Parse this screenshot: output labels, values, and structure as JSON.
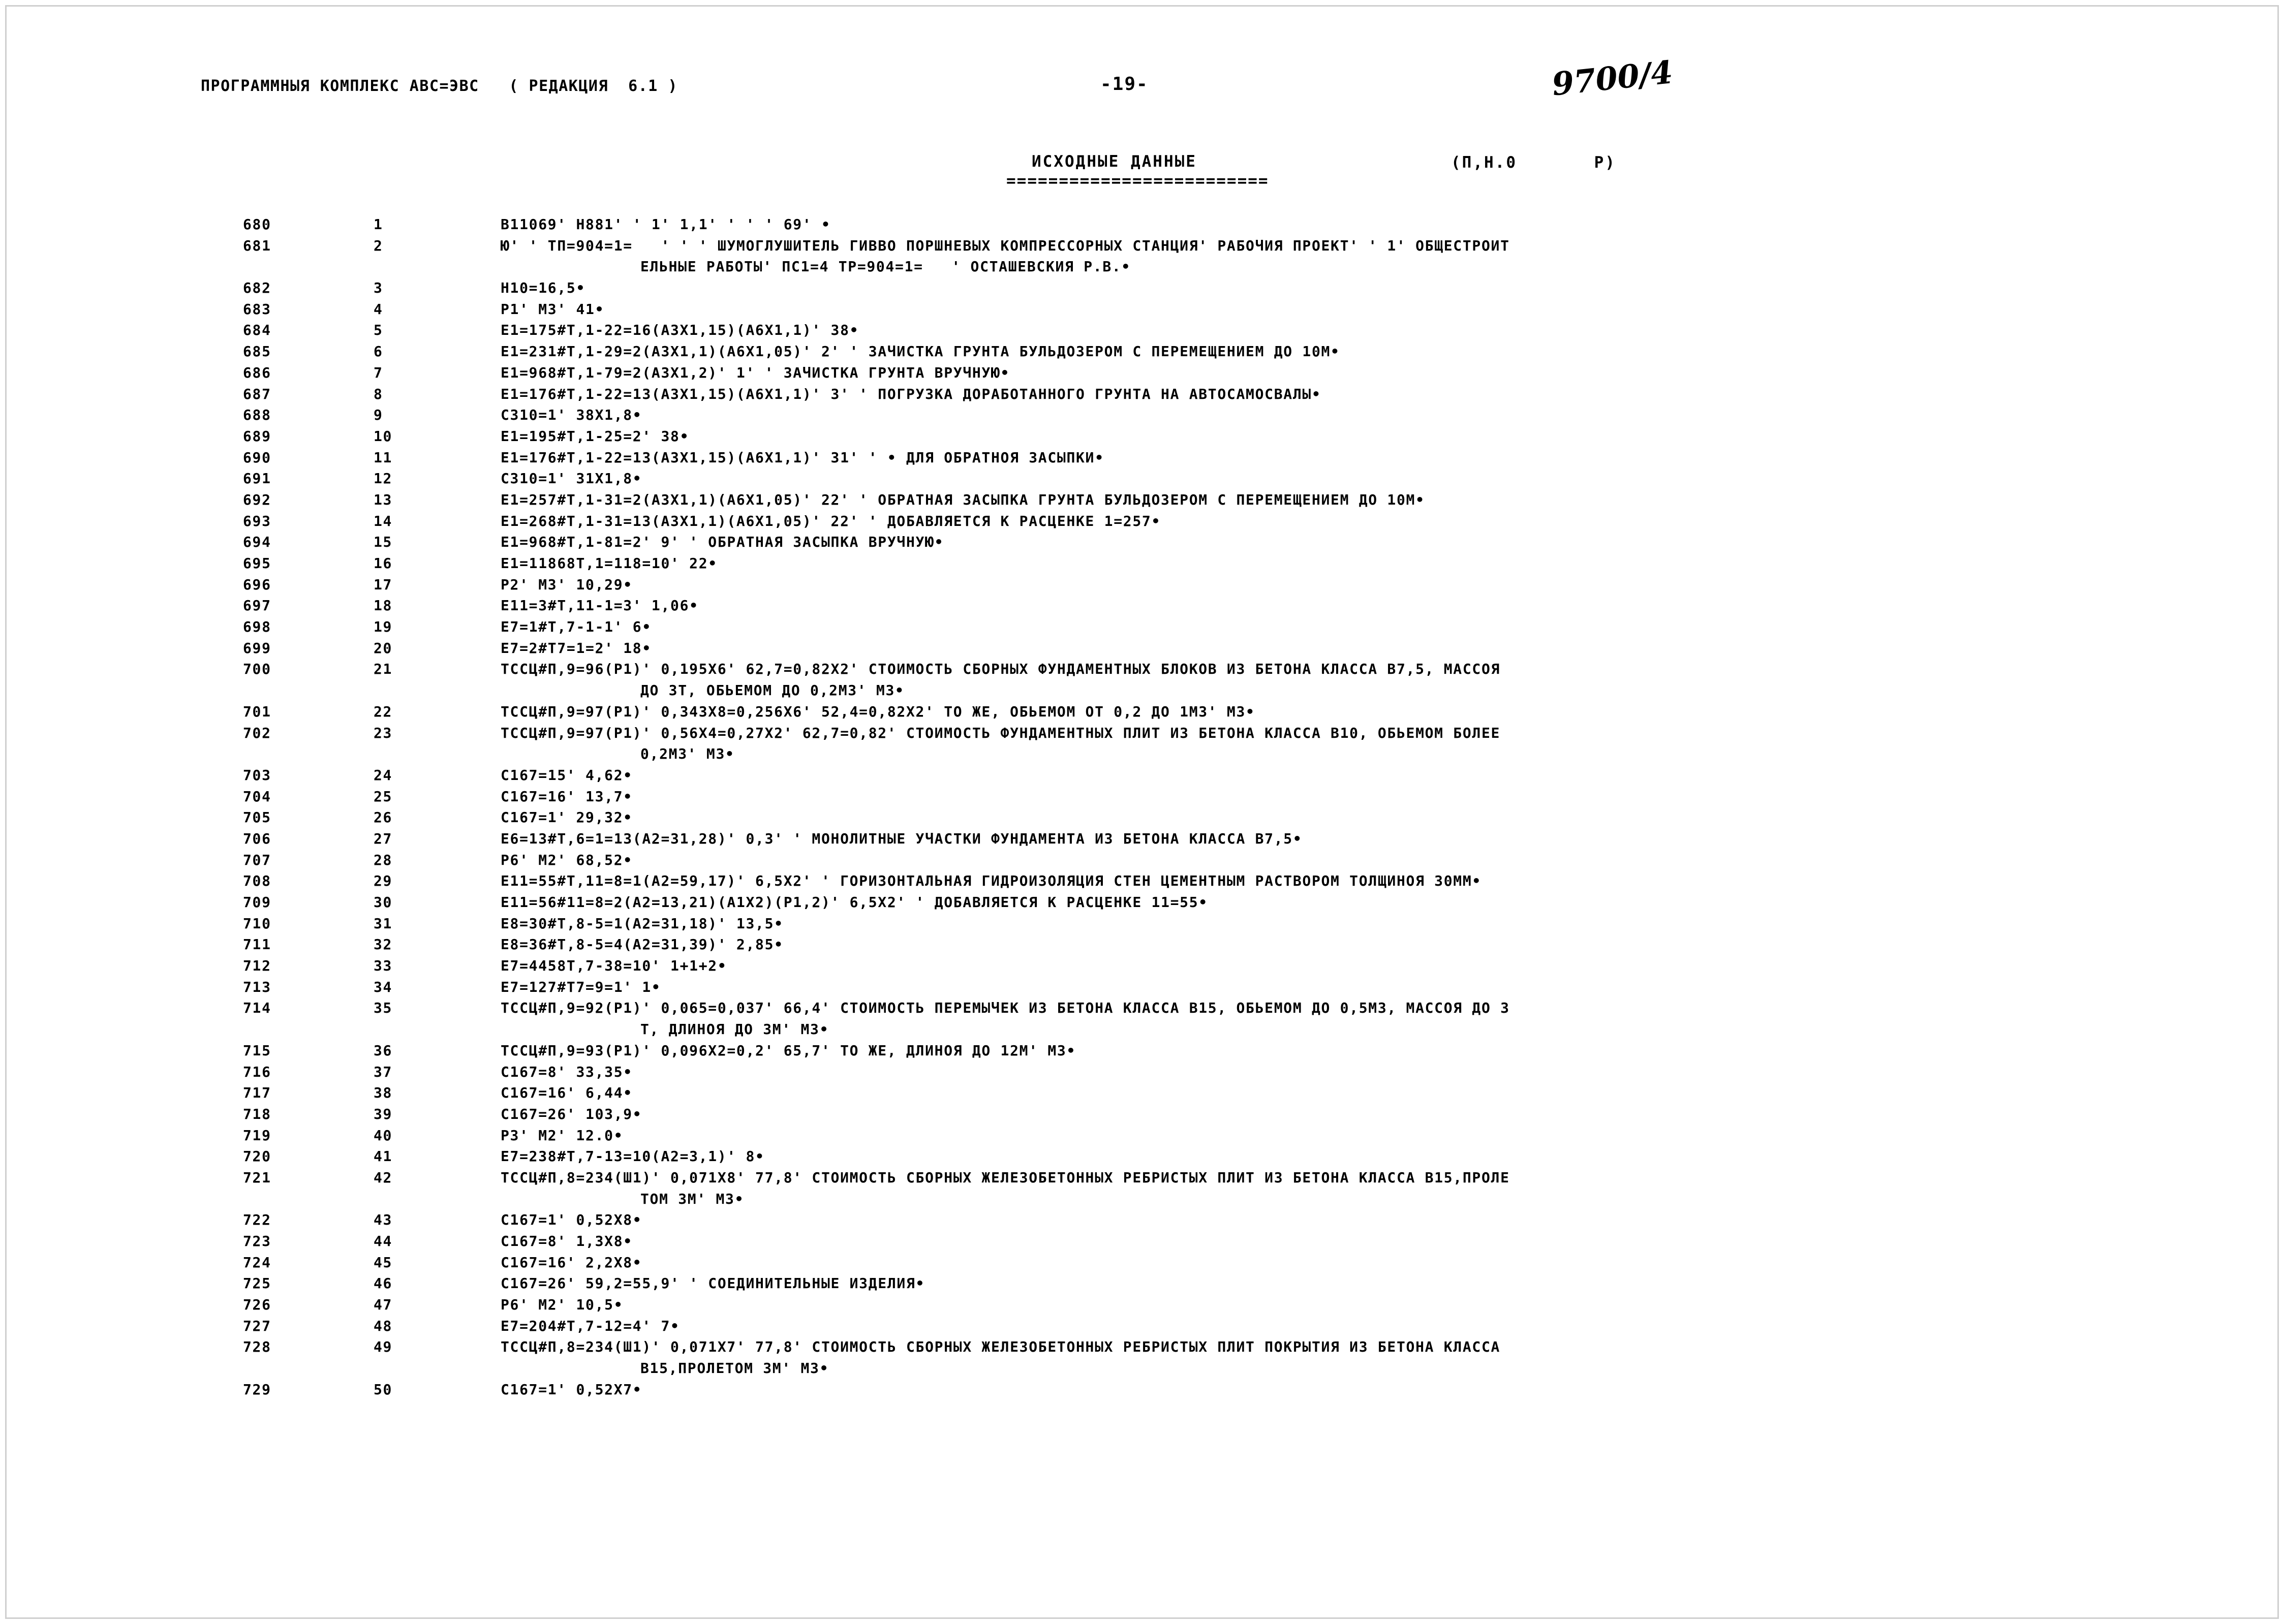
{
  "document": {
    "header": {
      "program_complex": "ПРОГРАММНЫЯ КОМПЛЕКС АВС=ЭВС   ( РЕДАКЦИЯ  6.1 )",
      "page_marker": "-19-",
      "handwritten_annotation": "9700/4",
      "section_title": "ИСХОДНЫЕ ДАННЫЕ",
      "section_rule": "=========================",
      "right_note": "(П,Н.0       Р)"
    },
    "rows": [
      {
        "num": "680",
        "seq": "1",
        "text": "B11069' H881' ' 1' 1,1' ' ' ' 69' •"
      },
      {
        "num": "681",
        "seq": "2",
        "text": "Ю' ' ТП=904=1=   ' ' ' ШУМОГЛУШИТЕЛЬ ГИВВО ПОРШНЕВЫХ КОМПРЕССОРНЫХ СТАНЦИЯ' РАБОЧИЯ ПРОЕКТ' ' 1' ОБЩЕСТРОИТ"
      },
      {
        "num": "",
        "seq": "",
        "text": "ЕЛЬНЫЕ РАБОТЫ' ПС1=4 ТР=904=1=   ' ОСТАШЕВСКИЯ Р.В.•",
        "cont": true
      },
      {
        "num": "682",
        "seq": "3",
        "text": "H10=16,5•"
      },
      {
        "num": "683",
        "seq": "4",
        "text": "Р1' М3' 41•"
      },
      {
        "num": "684",
        "seq": "5",
        "text": "E1=175#Т,1-22=16(А3Х1,15)(А6Х1,1)' 38•"
      },
      {
        "num": "685",
        "seq": "6",
        "text": "E1=231#Т,1-29=2(А3Х1,1)(А6Х1,05)' 2' ' ЗАЧИСТКА ГРУНТА БУЛЬДОЗЕРОМ С ПЕРЕМЕЩЕНИЕМ ДО 10М•"
      },
      {
        "num": "686",
        "seq": "7",
        "text": "E1=968#Т,1-79=2(А3Х1,2)' 1' ' ЗАЧИСТКА ГРУНТА ВРУЧНУЮ•"
      },
      {
        "num": "687",
        "seq": "8",
        "text": "E1=176#Т,1-22=13(А3Х1,15)(А6Х1,1)' 3' ' ПОГРУЗКА ДОРАБОТАННОГО ГРУНТА НА АВТОСАМОСВАЛЫ•"
      },
      {
        "num": "688",
        "seq": "9",
        "text": "C310=1' 38Х1,8•"
      },
      {
        "num": "689",
        "seq": "10",
        "text": "E1=195#Т,1-25=2' 38•"
      },
      {
        "num": "690",
        "seq": "11",
        "text": "E1=176#Т,1-22=13(А3Х1,15)(А6Х1,1)' 31' ' • ДЛЯ ОБРАТНОЯ ЗАСЫПКИ•"
      },
      {
        "num": "691",
        "seq": "12",
        "text": "C310=1' 31Х1,8•"
      },
      {
        "num": "692",
        "seq": "13",
        "text": "E1=257#Т,1-31=2(А3Х1,1)(А6Х1,05)' 22' ' ОБРАТНАЯ ЗАСЫПКА ГРУНТА БУЛЬДОЗЕРОМ С ПЕРЕМЕЩЕНИЕМ ДО 10М•"
      },
      {
        "num": "693",
        "seq": "14",
        "text": "E1=268#Т,1-31=13(А3Х1,1)(А6Х1,05)' 22' ' ДОБАВЛЯЕТСЯ К РАСЦЕНКЕ 1=257•"
      },
      {
        "num": "694",
        "seq": "15",
        "text": "E1=968#Т,1-81=2' 9' ' ОБРАТНАЯ ЗАСЫПКА ВРУЧНУЮ•"
      },
      {
        "num": "695",
        "seq": "16",
        "text": "E1=11868Т,1=118=10' 22•"
      },
      {
        "num": "696",
        "seq": "17",
        "text": "Р2' М3' 10,29•"
      },
      {
        "num": "697",
        "seq": "18",
        "text": "E11=3#Т,11-1=3' 1,06•"
      },
      {
        "num": "698",
        "seq": "19",
        "text": "E7=1#Т,7-1-1' 6•"
      },
      {
        "num": "699",
        "seq": "20",
        "text": "E7=2#Т7=1=2' 18•"
      },
      {
        "num": "700",
        "seq": "21",
        "text": "ТССЦ#П,9=96(Р1)' 0,195Х6' 62,7=0,82Х2' СТОИМОСТЬ СБОРНЫХ ФУНДАМЕНТНЫХ БЛОКОВ ИЗ БЕТОНА КЛАССА В7,5, МАССОЯ"
      },
      {
        "num": "",
        "seq": "",
        "text": "ДО 3Т, ОБЬЕМОМ ДО 0,2М3' М3•",
        "cont": true
      },
      {
        "num": "701",
        "seq": "22",
        "text": "ТССЦ#П,9=97(Р1)' 0,343Х8=0,256Х6' 52,4=0,82Х2' ТО ЖЕ, ОБЬЕМОМ ОТ 0,2 ДО 1М3' М3•"
      },
      {
        "num": "702",
        "seq": "23",
        "text": "ТССЦ#П,9=97(Р1)' 0,56Х4=0,27Х2' 62,7=0,82' СТОИМОСТЬ ФУНДАМЕНТНЫХ ПЛИТ ИЗ БЕТОНА КЛАССА В10, ОБЬЕМОМ БОЛЕЕ"
      },
      {
        "num": "",
        "seq": "",
        "text": "0,2М3' М3•",
        "cont": true
      },
      {
        "num": "703",
        "seq": "24",
        "text": "C167=15' 4,62•"
      },
      {
        "num": "704",
        "seq": "25",
        "text": "C167=16' 13,7•"
      },
      {
        "num": "705",
        "seq": "26",
        "text": "C167=1' 29,32•"
      },
      {
        "num": "706",
        "seq": "27",
        "text": "E6=13#Т,6=1=13(А2=31,28)' 0,3' ' МОНОЛИТНЫЕ УЧАСТКИ ФУНДАМЕНТА ИЗ БЕТОНА КЛАССА В7,5•"
      },
      {
        "num": "707",
        "seq": "28",
        "text": "Р6' М2' 68,52•"
      },
      {
        "num": "708",
        "seq": "29",
        "text": "E11=55#Т,11=8=1(А2=59,17)' 6,5Х2' ' ГОРИЗОНТАЛЬНАЯ ГИДРОИЗОЛЯЦИЯ СТЕН ЦЕМЕНТНЫМ РАСТВОРОМ ТОЛЩИНОЯ 30ММ•"
      },
      {
        "num": "709",
        "seq": "30",
        "text": "E11=56#11=8=2(А2=13,21)(А1Х2)(Р1,2)' 6,5Х2' ' ДОБАВЛЯЕТСЯ К РАСЦЕНКЕ 11=55•"
      },
      {
        "num": "710",
        "seq": "31",
        "text": "E8=30#Т,8-5=1(А2=31,18)' 13,5•"
      },
      {
        "num": "711",
        "seq": "32",
        "text": "E8=36#Т,8-5=4(А2=31,39)' 2,85•"
      },
      {
        "num": "712",
        "seq": "33",
        "text": "E7=4458Т,7-38=10' 1+1+2•"
      },
      {
        "num": "713",
        "seq": "34",
        "text": "E7=127#Т7=9=1' 1•"
      },
      {
        "num": "714",
        "seq": "35",
        "text": "ТССЦ#П,9=92(Р1)' 0,065=0,037' 66,4' СТОИМОСТЬ ПЕРЕМЫЧЕК ИЗ БЕТОНА КЛАССА В15, ОБЬЕМОМ ДО 0,5М3, МАССОЯ ДО 3"
      },
      {
        "num": "",
        "seq": "",
        "text": "Т, ДЛИНОЯ ДО 3М' М3•",
        "cont": true
      },
      {
        "num": "715",
        "seq": "36",
        "text": "ТССЦ#П,9=93(Р1)' 0,096Х2=0,2' 65,7' ТО ЖЕ, ДЛИНОЯ ДО 12М' М3•"
      },
      {
        "num": "716",
        "seq": "37",
        "text": "C167=8' 33,35•"
      },
      {
        "num": "717",
        "seq": "38",
        "text": "C167=16' 6,44•"
      },
      {
        "num": "718",
        "seq": "39",
        "text": "C167=26' 103,9•"
      },
      {
        "num": "719",
        "seq": "40",
        "text": "Р3' М2' 12.0•"
      },
      {
        "num": "720",
        "seq": "41",
        "text": "E7=238#Т,7-13=10(А2=3,1)' 8•"
      },
      {
        "num": "721",
        "seq": "42",
        "text": "ТССЦ#П,8=234(Ш1)' 0,071Х8' 77,8' СТОИМОСТЬ СБОРНЫХ ЖЕЛЕЗОБЕТОННЫХ РЕБРИСТЫХ ПЛИТ ИЗ БЕТОНА КЛАССА В15,ПРОЛЕ"
      },
      {
        "num": "",
        "seq": "",
        "text": "ТОМ 3М' М3•",
        "cont": true
      },
      {
        "num": "722",
        "seq": "43",
        "text": "C167=1' 0,52Х8•"
      },
      {
        "num": "723",
        "seq": "44",
        "text": "C167=8' 1,3Х8•"
      },
      {
        "num": "724",
        "seq": "45",
        "text": "C167=16' 2,2Х8•"
      },
      {
        "num": "725",
        "seq": "46",
        "text": "C167=26' 59,2=55,9' ' СОЕДИНИТЕЛЬНЫЕ ИЗДЕЛИЯ•"
      },
      {
        "num": "726",
        "seq": "47",
        "text": "Р6' М2' 10,5•"
      },
      {
        "num": "727",
        "seq": "48",
        "text": "E7=204#Т,7-12=4' 7•"
      },
      {
        "num": "728",
        "seq": "49",
        "text": "ТССЦ#П,8=234(Ш1)' 0,071Х7' 77,8' СТОИМОСТЬ СБОРНЫХ ЖЕЛЕЗОБЕТОННЫХ РЕБРИСТЫХ ПЛИТ ПОКРЫТИЯ ИЗ БЕТОНА КЛАССА"
      },
      {
        "num": "",
        "seq": "",
        "text": "В15,ПРОЛЕТОМ 3М' М3•",
        "cont": true
      },
      {
        "num": "729",
        "seq": "50",
        "text": "C167=1' 0,52Х7•"
      }
    ]
  }
}
